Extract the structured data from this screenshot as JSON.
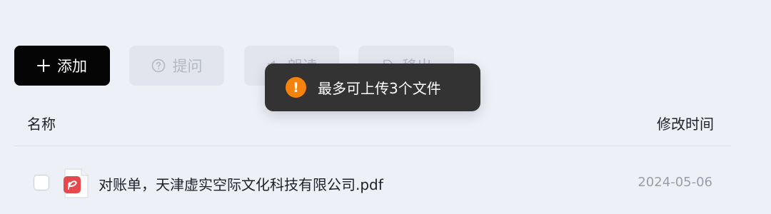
{
  "toolbar": {
    "add_label": "添加",
    "ask_label": "提问",
    "read_label": "朗读",
    "move_label": "移出"
  },
  "table": {
    "headers": {
      "name": "名称",
      "modified": "修改时间"
    },
    "rows": [
      {
        "name": "对账单，天津虚实空际文化科技有限公司.pdf",
        "modified": "2024-05-06",
        "icon": "pdf-file-icon",
        "checked": false
      }
    ]
  },
  "toast": {
    "message": "最多可上传3个文件",
    "icon": "warning-icon",
    "icon_color": "#f5820d"
  },
  "colors": {
    "primary_button": "#050505",
    "disabled_button": "#e3e5ee",
    "background": "#eef0f8",
    "pdf_accent": "#e5484d"
  }
}
